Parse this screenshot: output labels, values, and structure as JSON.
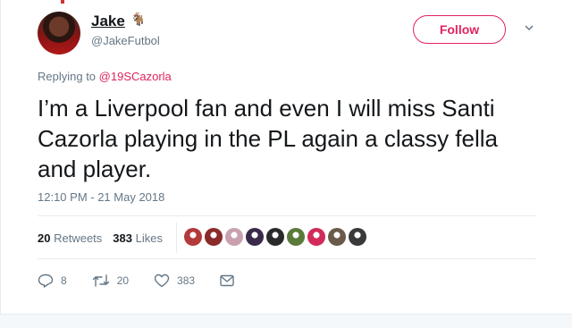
{
  "user": {
    "display_name": "Jake",
    "handle": "@JakeFutbol",
    "badge_icon": "goat-emoji-icon",
    "badge_glyph": "🐐"
  },
  "follow_label": "Follow",
  "replying": {
    "prefix": "Replying to ",
    "mention": "@19SCazorla"
  },
  "tweet": {
    "text": "I’m a Liverpool fan and even I will miss Santi Cazorla playing in the PL again a classy fella and player.",
    "timestamp": "12:10 PM - 21 May 2018"
  },
  "stats": {
    "retweets_count": "20",
    "retweets_label": "Retweets",
    "likes_count": "383",
    "likes_label": "Likes"
  },
  "liker_colors": [
    "#b33a3a",
    "#8a2a2a",
    "#c9a0b0",
    "#3a2a4a",
    "#2a2a2a",
    "#5a7a3a",
    "#d22a5a",
    "#6a5a4a",
    "#3a3a3a"
  ],
  "actions": {
    "reply_count": "8",
    "retweet_count": "20",
    "like_count": "383"
  },
  "colors": {
    "accent": "#e0245e",
    "muted": "#657786",
    "text": "#14171a"
  }
}
